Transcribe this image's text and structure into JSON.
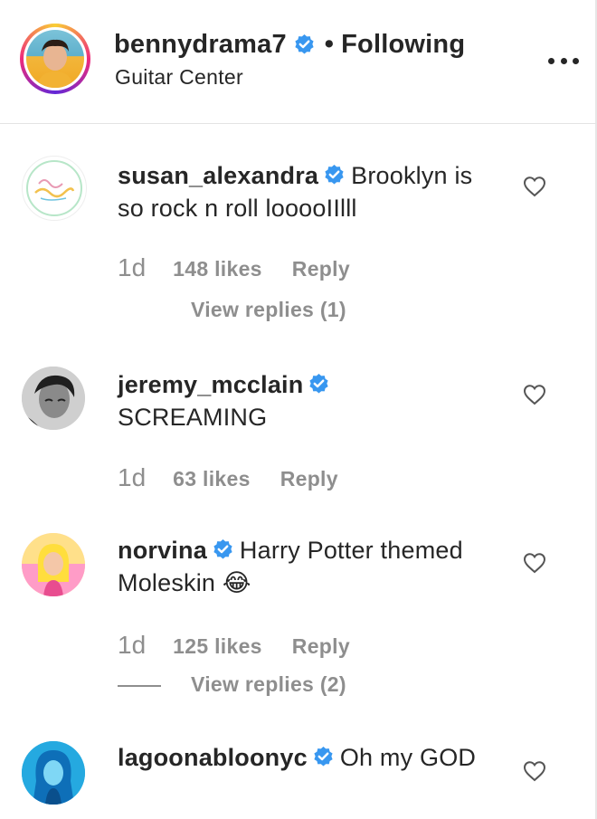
{
  "post": {
    "username": "bennydrama7",
    "separator": "•",
    "follow_status": "Following",
    "location": "Guitar Center",
    "avatar_icon": "profile-avatar"
  },
  "colors": {
    "verified": "#3897f0",
    "muted": "#8e8e8e",
    "text": "#262626"
  },
  "comments": [
    {
      "username": "susan_alexandra",
      "text": "Brooklyn is so rock n roll looooIIlll",
      "time": "1d",
      "likes": "148 likes",
      "reply": "Reply",
      "view_replies": "View replies (1)"
    },
    {
      "username": "jeremy_mcclain",
      "text": "SCREAMING",
      "time": "1d",
      "likes": "63 likes",
      "reply": "Reply"
    },
    {
      "username": "norvina",
      "text": "Harry Potter themed Moleskin 😂",
      "time": "1d",
      "likes": "125 likes",
      "reply": "Reply",
      "view_replies": "View replies (2)"
    },
    {
      "username": "lagoonabloonyc",
      "text": "Oh my GOD"
    }
  ]
}
